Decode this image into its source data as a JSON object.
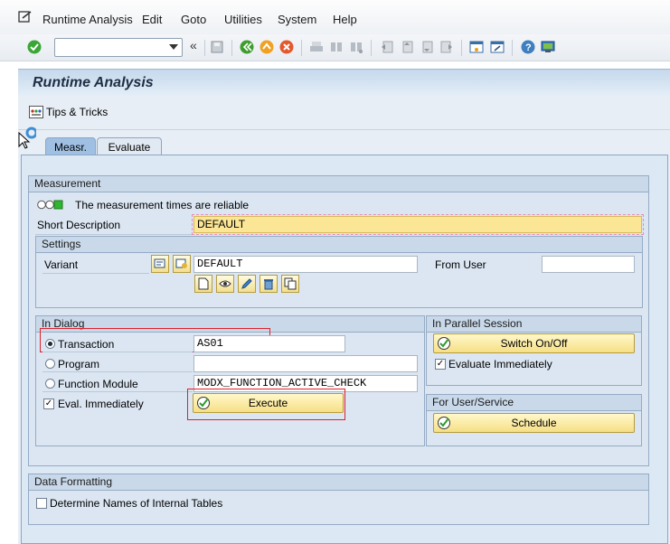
{
  "menu": {
    "runtime_analysis": "Runtime Analysis",
    "edit": "Edit",
    "goto": "Goto",
    "utilities": "Utilities",
    "system": "System",
    "help": "Help"
  },
  "toolbar": {
    "command_field_value": "",
    "icons": [
      "enter-icon",
      "command-dropdown-icon",
      "collapse-icon",
      "save-icon",
      "back-icon",
      "exit-icon",
      "cancel-icon",
      "print-icon",
      "find-icon",
      "find-next-icon",
      "first-page-icon",
      "prev-page-icon",
      "next-page-icon",
      "last-page-icon",
      "new-session-icon",
      "shortcut-icon",
      "help-icon",
      "layout-icon"
    ]
  },
  "title": "Runtime Analysis",
  "app_toolbar": {
    "tips_label": "Tips & Tricks"
  },
  "tabs": [
    "Measr.",
    "Evaluate"
  ],
  "measurement": {
    "header": "Measurement",
    "reliable_text": "The measurement times are reliable",
    "short_desc_label": "Short Description",
    "short_desc_value": "DEFAULT"
  },
  "settings": {
    "header": "Settings",
    "variant_label": "Variant",
    "variant_value": "DEFAULT",
    "from_user_label": "From User",
    "from_user_value": ""
  },
  "in_dialog": {
    "header": "In Dialog",
    "transaction_label": "Transaction",
    "transaction_value": "AS01",
    "program_label": "Program",
    "program_value": "",
    "function_module_label": "Function Module",
    "function_module_value": "MODX_FUNCTION_ACTIVE_CHECK",
    "eval_immediately_label": "Eval. Immediately",
    "execute_label": "Execute"
  },
  "parallel": {
    "header": "In Parallel Session",
    "switch_label": "Switch On/Off",
    "evaluate_immediately_label": "Evaluate Immediately"
  },
  "user_service": {
    "header": "For User/Service",
    "schedule_label": "Schedule"
  },
  "data_formatting": {
    "header": "Data Formatting",
    "determine_names_label": "Determine Names of Internal Tables"
  },
  "colors": {
    "highlight_field": "#fbe696",
    "red_outline": "#e0202a",
    "button_yellow": "#f6df86"
  }
}
